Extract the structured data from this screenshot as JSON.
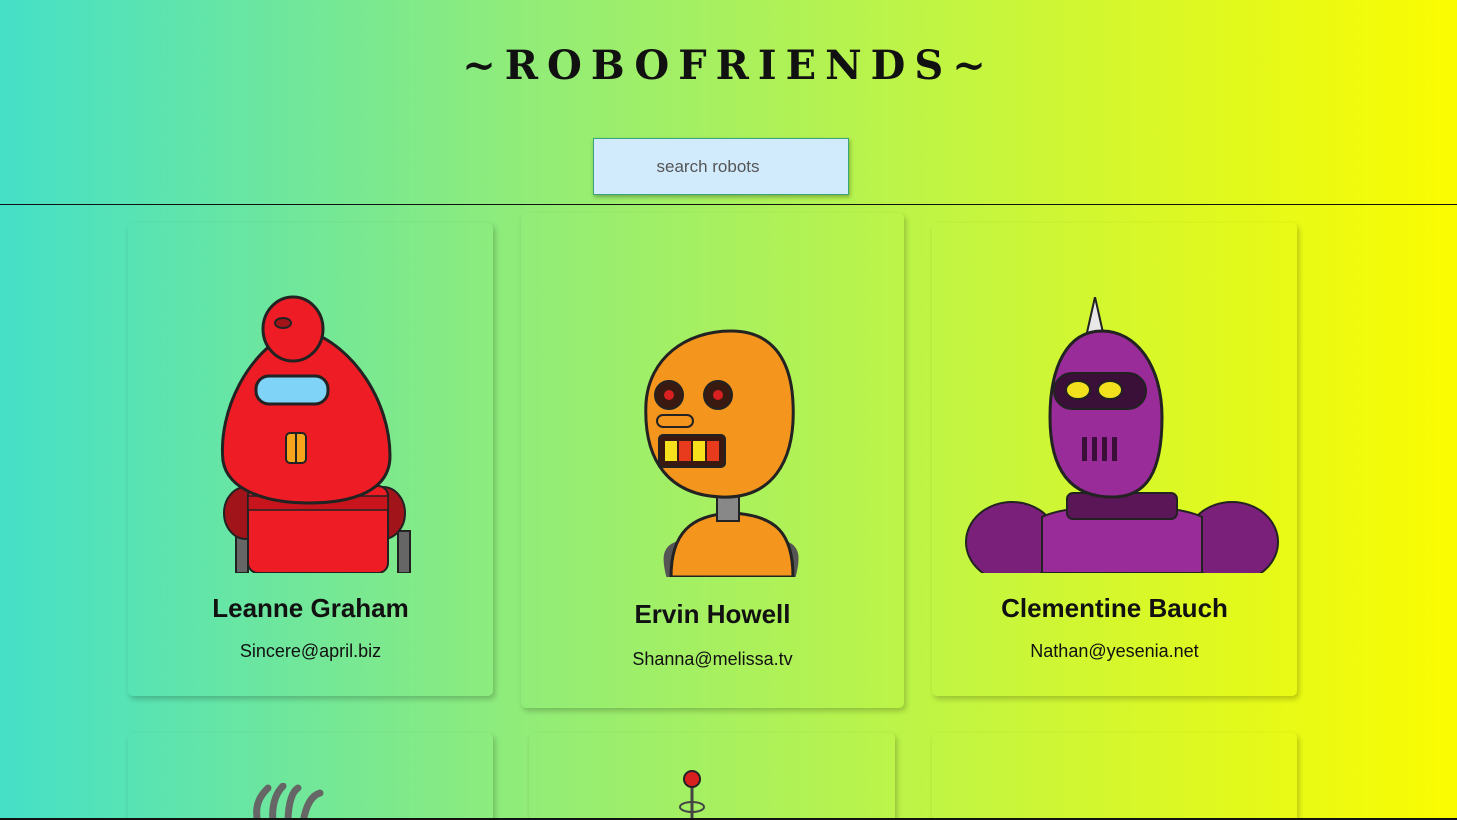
{
  "header": {
    "title": "~ROBOFRIENDS~"
  },
  "search": {
    "placeholder": "search robots",
    "value": ""
  },
  "robots": [
    {
      "name": "Leanne Graham",
      "email": "Sincere@april.biz",
      "icon": "red-robot-avatar",
      "color": "#ee1c24"
    },
    {
      "name": "Ervin Howell",
      "email": "Shanna@melissa.tv",
      "icon": "orange-robot-avatar",
      "color": "#f4951d"
    },
    {
      "name": "Clementine Bauch",
      "email": "Nathan@yesenia.net",
      "icon": "purple-robot-avatar",
      "color": "#8a2a8a"
    }
  ],
  "colors": {
    "gradient_start": "#45e0c8",
    "gradient_end": "#fbfc00",
    "search_bg": "#d1ebfd"
  }
}
